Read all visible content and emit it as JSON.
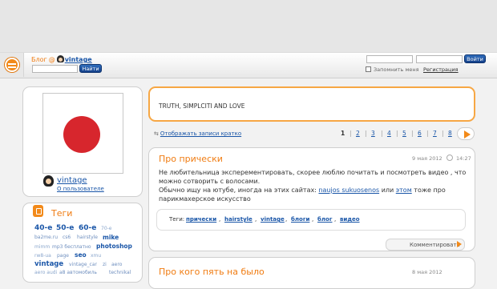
{
  "header": {
    "blog_label": "Блог",
    "sep": "@",
    "username": "vintage",
    "search_button": "Найти",
    "login_button": "Войти",
    "remember_label": "Запомнить меня",
    "register_link": "Регистрация"
  },
  "profile": {
    "username": "vintage",
    "about_link": "О пользователе"
  },
  "tags_widget": {
    "title": "Теги",
    "tags": [
      "40-е",
      "50-е",
      "60-е",
      "70-е",
      "ba2me.ru",
      "cs6",
      "hairstyle",
      "mike",
      "mimm",
      "mp3 бесплатно",
      "photoshop",
      "rw8-ua",
      "page",
      "seo",
      "xmu",
      "vintage",
      "vintage_car",
      "zi",
      "aero",
      "aero audi",
      "a8 автомобиль",
      "technikal"
    ]
  },
  "intro": {
    "text": "TRUTH, SIMPLCITI AND LOVE"
  },
  "listing": {
    "short_view_link": "Отображать записи кратко",
    "pages": [
      "1",
      "2",
      "3",
      "4",
      "5",
      "6",
      "7",
      "8"
    ],
    "current_page": "1"
  },
  "post": {
    "title": "Про прически",
    "date": "9 мая 2012",
    "time": "14:27",
    "line1": "Не любительница эксперементировать, скорее люблю почитать и посмотреть видео , что",
    "line2": "можно сотворить с волосами.",
    "line3_pre": "Обычно ищу на ютубе, иногда на этих сайтах:",
    "link1": "naujos sukuosenos",
    "mid": "или",
    "link2": "этом",
    "line3_post": "тоже про",
    "line4": "парикмахерское искусство",
    "tags_label": "Теги:",
    "tags": [
      "прически",
      "hairstyle",
      "vintage",
      "блоги",
      "блог",
      "видео"
    ],
    "comment_button": "Комментировать"
  },
  "post2": {
    "title": "Про кого пять на было",
    "date": "8 мая 2012"
  }
}
